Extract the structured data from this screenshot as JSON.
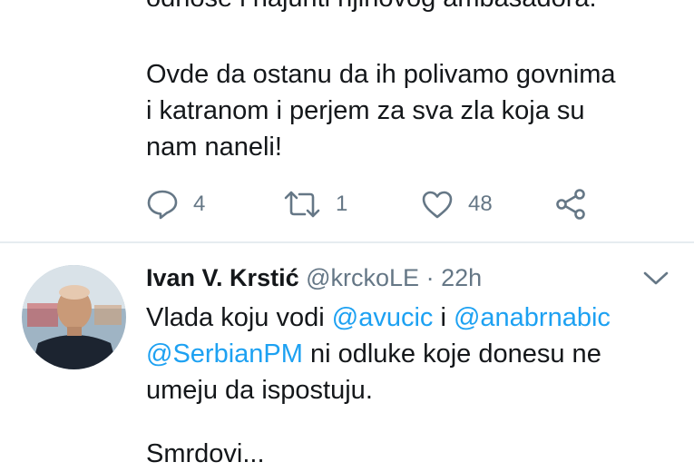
{
  "tweet_top": {
    "cut_line": "odnose i najuriti njihovog ambasadora.",
    "lines": [
      "Ovde da ostanu da ih polivamo govnima",
      "i katranom i perjem za sva zla koja su",
      "nam naneli!"
    ],
    "actions": {
      "reply_count": "4",
      "retweet_count": "1",
      "like_count": "48"
    },
    "icons": [
      "reply-icon",
      "retweet-icon",
      "like-icon",
      "share-icon"
    ]
  },
  "tweet_bottom": {
    "author_name": "Ivan V. Krstić",
    "handle": "@krckoLE",
    "separator": "·",
    "time": "22h",
    "line1_prefix": "Vlada koju vodi ",
    "mention1": "@avucic",
    "line1_middle": " i ",
    "mention2": "@anabrnabic",
    "mention3": "@SerbianPM",
    "line2_suffix": " ni odluke koje donesu ne",
    "line3": "umeju da ispostuju.",
    "cut_line": "Smrdovi..."
  },
  "colors": {
    "text": "#14171a",
    "secondary": "#657786",
    "accent": "#1da1f2",
    "divider": "#e6ecf0"
  }
}
